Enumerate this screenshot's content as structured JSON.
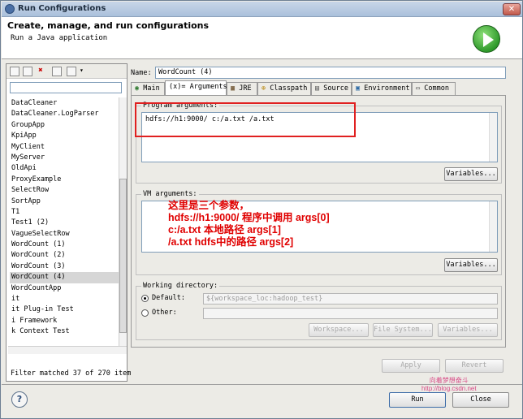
{
  "window": {
    "title": "Run Configurations",
    "close_glyph": "✕"
  },
  "header": {
    "title": "Create, manage, and run configurations",
    "subtitle": "Run a Java application",
    "icon": "run-play-icon"
  },
  "left": {
    "filter_value": "",
    "items": [
      "DataCleaner",
      "DataCleaner.LogParser",
      "GroupApp",
      "KpiApp",
      "MyClient",
      "MyServer",
      "OldApi",
      "ProxyExample",
      "SelectRow",
      "SortApp",
      "T1",
      "Test1 (2)",
      "VagueSelectRow",
      "WordCount (1)",
      "WordCount (2)",
      "WordCount (3)",
      "WordCount (4)",
      "WordCountApp",
      "it",
      "it Plug-in Test",
      "i Framework",
      "k Context Test"
    ],
    "selected_index": 16,
    "filter_message": "Filter matched 37 of 270 item"
  },
  "config": {
    "name_label": "Name:",
    "name_value": "WordCount (4)",
    "tabs": [
      "Main",
      "(x)= Arguments",
      "JRE",
      "Classpath",
      "Source",
      "Environment",
      "Common"
    ],
    "active_tab": 1,
    "program_args_label": "Program arguments:",
    "program_args_value": "hdfs://h1:9000/ c:/a.txt /a.txt",
    "variables_label": "Variables...",
    "vm_args_label": "VM arguments:",
    "annotation": [
      "这里是三个参数，",
      "hdfs://h1:9000/ 程序中调用 args[0]",
      "c:/a.txt 本地路径 args[1]",
      "/a.txt hdfs中的路径 args[2]"
    ],
    "workdir_label": "Working directory:",
    "default_label": "Default:",
    "default_value": "${workspace_loc:hadoop_test}",
    "other_label": "Other:",
    "workspace_btn": "Workspace...",
    "filesystem_btn": "File System...",
    "variables_btn": "Variables..."
  },
  "buttons": {
    "apply": "Apply",
    "revert": "Revert",
    "run": "Run",
    "close": "Close",
    "help": "?"
  },
  "watermark": {
    "line1": "向着梦想奋斗",
    "line2": "http://blog.csdn.net"
  },
  "colors": {
    "annotation": "#e00000",
    "highlight_box": "#e02020"
  }
}
